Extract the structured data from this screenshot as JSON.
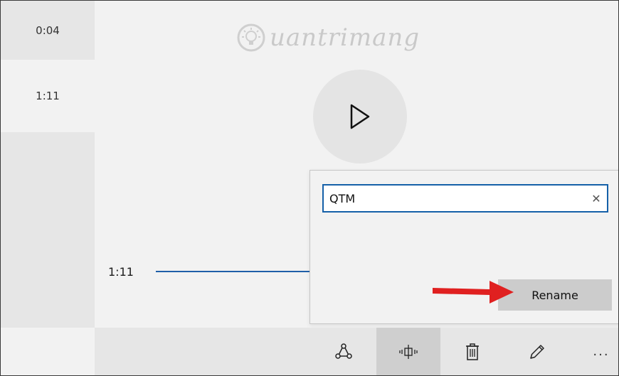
{
  "recordings": [
    {
      "duration": "0:04"
    },
    {
      "duration": "1:11"
    }
  ],
  "watermark": {
    "text": "uantrimang"
  },
  "player": {
    "play_icon": "play-icon",
    "current_time": "1:11"
  },
  "rename_dialog": {
    "name_value": "QTM",
    "clear_icon": "close-icon",
    "clear_glyph": "✕",
    "rename_label": "Rename"
  },
  "toolbar": {
    "items": [
      {
        "icon": "share-icon"
      },
      {
        "icon": "trim-icon"
      },
      {
        "icon": "delete-icon"
      },
      {
        "icon": "pencil-icon"
      },
      {
        "icon": "more-icon",
        "glyph": "..."
      }
    ]
  },
  "colors": {
    "accent": "#1560a8",
    "arrow": "#e02020",
    "background": "#f2f2f2"
  }
}
